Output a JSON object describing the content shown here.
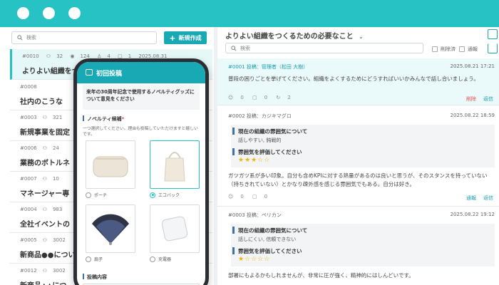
{
  "colors": {
    "accent": "#26c2c4",
    "button": "#19a9b4",
    "delete": "#e0504a",
    "link": "#1a9fb0",
    "star": "#f0b400"
  },
  "left": {
    "search_placeholder": "検索",
    "new_button": "新規作成",
    "rows": [
      {
        "id": "#0010",
        "users": "32",
        "views": "124",
        "likes": "4",
        "comments": "1",
        "date": "2025.08.31",
        "title": "よりよい組織をつ"
      },
      {
        "id": "#0008",
        "users": "",
        "views": "",
        "likes": "",
        "comments": "",
        "date": "",
        "title": "社内のこうな"
      },
      {
        "id": "#0003",
        "users": "321",
        "views": "",
        "likes": "",
        "comments": "",
        "date": "",
        "title": "新規事業を固定"
      },
      {
        "id": "#0006",
        "users": "24",
        "views": "",
        "likes": "",
        "comments": "",
        "date": "",
        "title": "業務のボトルネ"
      },
      {
        "id": "#0007",
        "users": "10",
        "views": "",
        "likes": "",
        "comments": "",
        "date": "",
        "title": "マネージャー専"
      },
      {
        "id": "#0004",
        "users": "983",
        "views": "",
        "likes": "",
        "comments": "",
        "date": "",
        "title": "全社イベントの"
      },
      {
        "id": "#0005",
        "users": "3002",
        "views": "",
        "likes": "",
        "comments": "",
        "date": "",
        "title": "新商品●●につい"
      },
      {
        "id": "#0012",
        "users": "3002",
        "views": "",
        "likes": "",
        "comments": "",
        "date": "",
        "title": "新商品▲▲につ"
      }
    ]
  },
  "right": {
    "title": "よりよい組織をつくるための必要なこと",
    "search_placeholder": "検索",
    "filter_deleted": "削除済",
    "filter_report": "通報",
    "posts": [
      {
        "meta": "#0001 投稿：管理者（松田 大樹）",
        "date": "2025.08.21 17:21",
        "text": "普段の困りごとを挙げてください。組織をよくするためにどうすればいいかみんなで話し合いましょう。",
        "likes": "0",
        "comments": "0",
        "reposts": "2",
        "action1": "削除",
        "action2": "返信"
      },
      {
        "meta": "#0002 投稿：カジキマグロ",
        "date": "2025.08.22 18:59",
        "q1": "現在の組織の雰囲気について",
        "a1": "話しやすい, 鈍戦的",
        "q2": "雰囲気を評価してください",
        "stars": "★★★☆☆",
        "text": "ガツガツ系が多い印象。自分も含めKPIに対する熱量があるのは良いと思うが、そのスタンスを持っていない（持ちきれていない）とかなり疎外感を感じる雰囲気でもある。自分は好き。",
        "likes": "0",
        "comments": "0",
        "action1": "通報",
        "action2": "返信"
      },
      {
        "meta": "#0003 投稿：ペリカン",
        "date": "2025.08.22 19:12",
        "q1": "現在の組織の雰囲気について",
        "a1": "話しにくい, 信頼できない",
        "q2": "雰囲気を評価してください",
        "stars": "★☆☆☆☆",
        "text": "部署にもよるかもしれませんが、非常に圧が強く、精神的にはしんどいです。"
      }
    ]
  },
  "phone": {
    "header": "初回投稿",
    "question": "来年の30周年記念で使用するノベルティグッズについて意見をください",
    "select_label": "ノベルティ候補",
    "required": "*",
    "hint": "一つ選択してください。理由も投稿していただけますと嬉しいです。",
    "options": [
      {
        "label": "ポーチ",
        "selected": false
      },
      {
        "label": "エコバック",
        "selected": true
      },
      {
        "label": "扇子",
        "selected": false
      },
      {
        "label": "充電器",
        "selected": false
      }
    ],
    "content_label": "投稿内容"
  }
}
